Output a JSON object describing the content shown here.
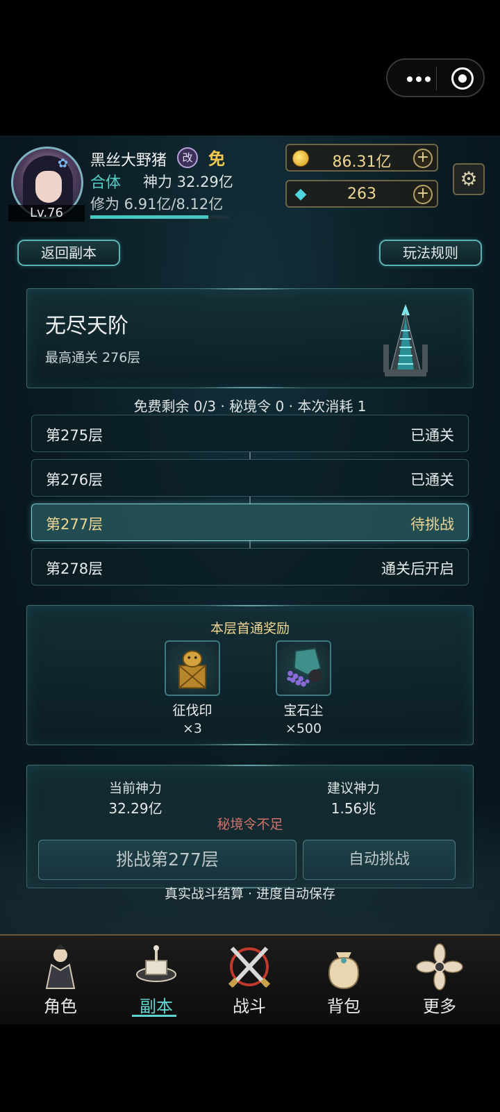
{
  "capsule": {
    "more_icon": "more-dots-icon",
    "close_icon": "target-circle-icon"
  },
  "player": {
    "name": "黑丝大野猪",
    "rename_badge": "改",
    "free_badge": "免",
    "level": "Lv.76",
    "realm": "合体",
    "power": "神力 32.29亿",
    "cultivation": "修为 6.91亿/8.12亿",
    "cultivation_progress": 0.851
  },
  "resources": {
    "gold": "86.31亿",
    "gems": "263",
    "plus": "+"
  },
  "buttons": {
    "back": "返回副本",
    "rules": "玩法规则",
    "challenge": "挑战第277层",
    "auto": "自动挑战"
  },
  "dungeon": {
    "title": "无尽天阶",
    "best": "最高通关 276层"
  },
  "status_line": "免费剩余 0/3 · 秘境令 0 · 本次消耗 1",
  "floors": [
    {
      "label": "第275层",
      "status": "已通关"
    },
    {
      "label": "第276层",
      "status": "已通关"
    },
    {
      "label": "第277层",
      "status": "待挑战"
    },
    {
      "label": "第278层",
      "status": "通关后开启"
    }
  ],
  "rewards": {
    "title": "本层首通奖励",
    "items": [
      {
        "name": "征伐印",
        "count": "×3",
        "icon": "seal-icon"
      },
      {
        "name": "宝石尘",
        "count": "×500",
        "icon": "gem-dust-icon"
      }
    ]
  },
  "battle": {
    "current_label": "当前神力",
    "current_value": "32.29亿",
    "suggest_label": "建议神力",
    "suggest_value": "1.56兆",
    "warning": "秘境令不足"
  },
  "footer": "真实战斗结算 · 进度自动保存",
  "tabs": [
    {
      "label": "角色",
      "icon": "character-icon"
    },
    {
      "label": "副本",
      "icon": "dungeon-icon",
      "active": true
    },
    {
      "label": "战斗",
      "icon": "crossed-swords-icon"
    },
    {
      "label": "背包",
      "icon": "bag-icon"
    },
    {
      "label": "更多",
      "icon": "more-flower-icon"
    }
  ],
  "colors": {
    "accent": "#5fd4d0",
    "gold": "#f0d692",
    "warning": "#e87a6e"
  }
}
